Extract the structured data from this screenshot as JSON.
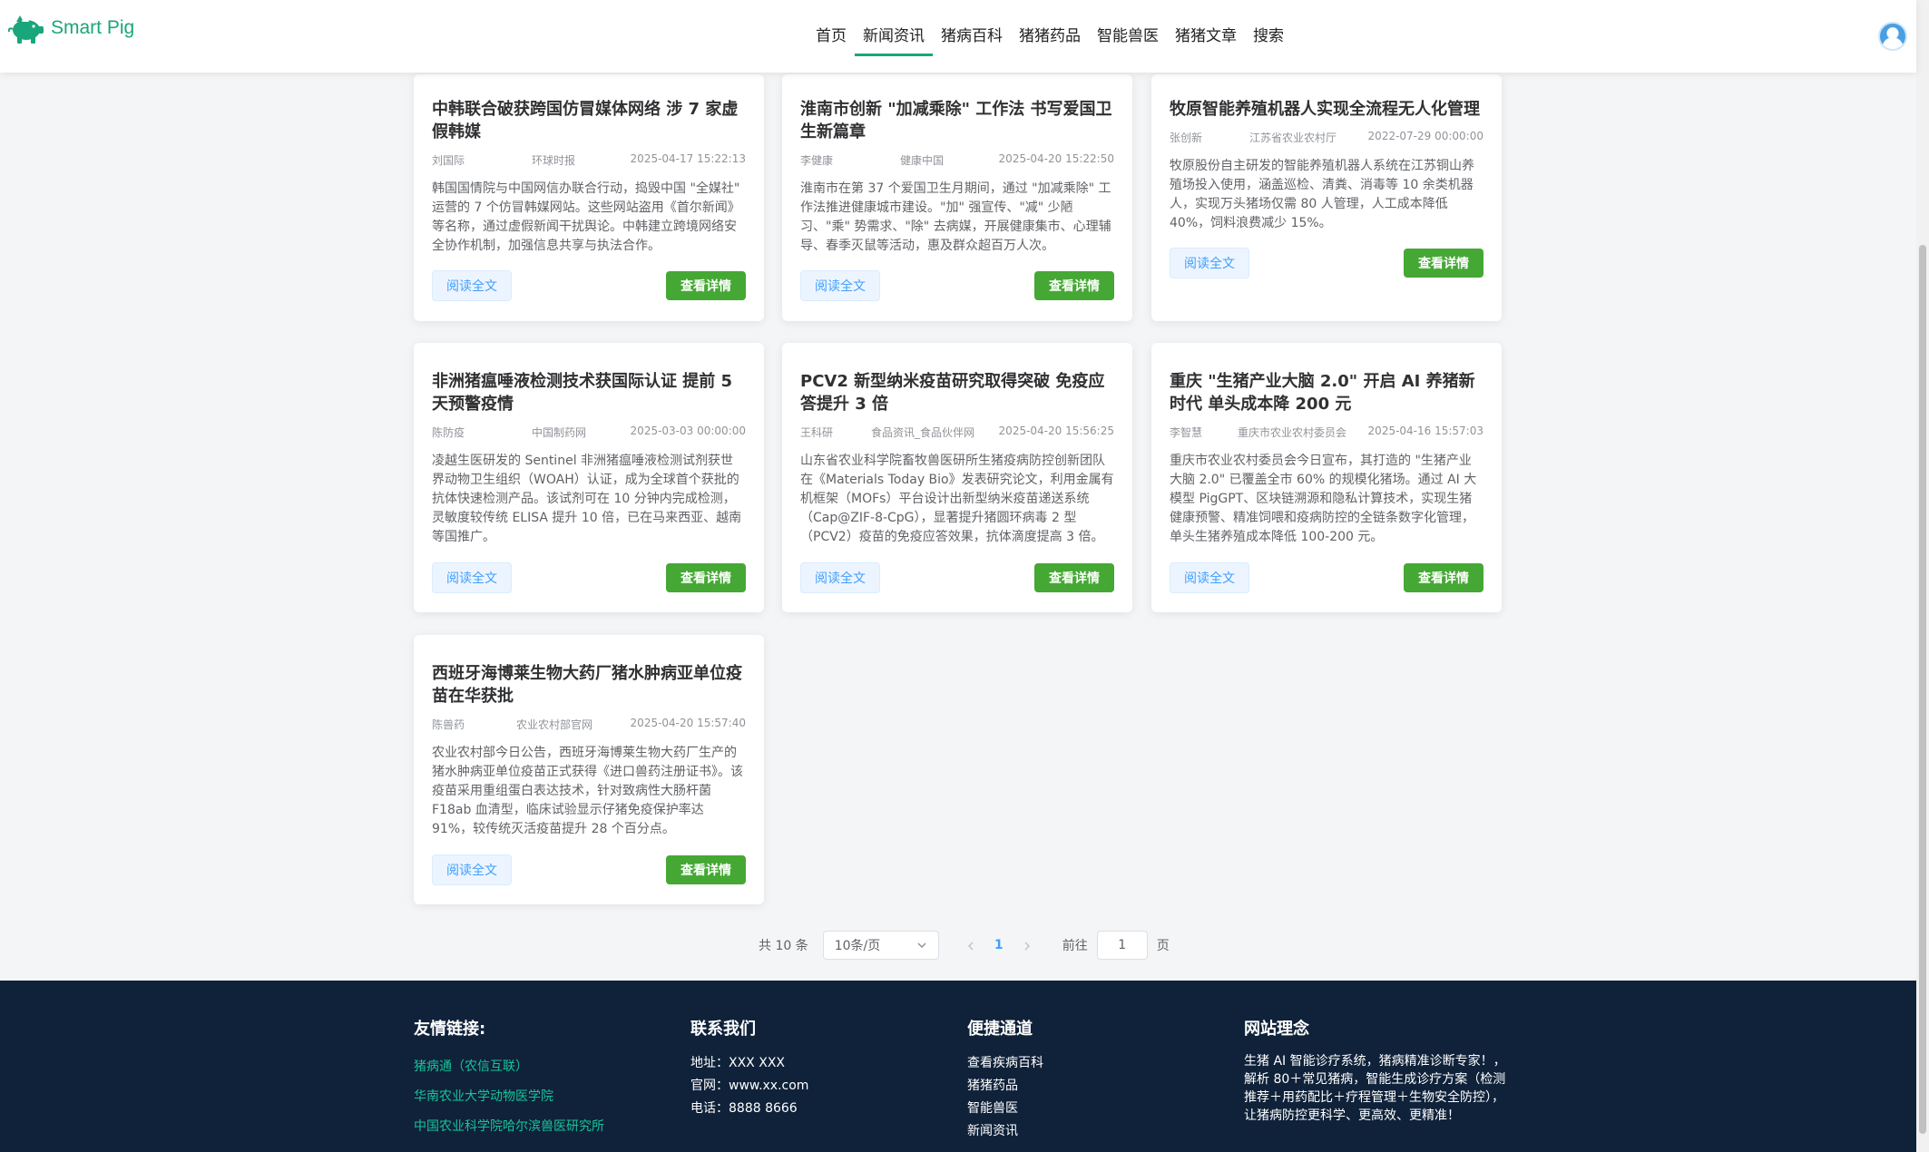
{
  "header": {
    "logo_text": "Smart Pig",
    "nav": [
      "首页",
      "新闻资讯",
      "猪病百科",
      "猪猪药品",
      "智能兽医",
      "猪猪文章",
      "搜索"
    ],
    "active_nav": "新闻资讯"
  },
  "cards": [
    {
      "title": "中韩联合破获跨国仿冒媒体网络 涉 7 家虚假韩媒",
      "author": "刘国际",
      "source": "环球时报",
      "date": "2025-04-17 15:22:13",
      "summary": "韩国国情院与中国网信办联合行动，捣毁中国 \"全媒社\" 运营的 7 个仿冒韩媒网站。这些网站盗用《首尔新闻》等名称，通过虚假新闻干扰舆论。中韩建立跨境网络安全协作机制，加强信息共享与执法合作。",
      "read_label": "阅读全文",
      "detail_label": "查看详情"
    },
    {
      "title": "淮南市创新 \"加减乘除\" 工作法 书写爱国卫生新篇章",
      "author": "李健康",
      "source": "健康中国",
      "date": "2025-04-20 15:22:50",
      "summary": "淮南市在第 37 个爱国卫生月期间，通过 \"加减乘除\" 工作法推进健康城市建设。\"加\" 强宣传、\"减\" 少陋习、\"乘\" 势需求、\"除\" 去病媒，开展健康集市、心理辅导、春季灭鼠等活动，惠及群众超百万人次。",
      "read_label": "阅读全文",
      "detail_label": "查看详情"
    },
    {
      "title": "牧原智能养殖机器人实现全流程无人化管理",
      "author": "张创新",
      "source": "江苏省农业农村厅",
      "date": "2022-07-29 00:00:00",
      "summary": "牧原股份自主研发的智能养殖机器人系统在江苏铜山养殖场投入使用，涵盖巡检、清粪、消毒等 10 余类机器人，实现万头猪场仅需 80 人管理，人工成本降低 40%，饲料浪费减少 15%。",
      "read_label": "阅读全文",
      "detail_label": "查看详情"
    },
    {
      "title": "非洲猪瘟唾液检测技术获国际认证 提前 5 天预警疫情",
      "author": "陈防疫",
      "source": "中国制药网",
      "date": "2025-03-03 00:00:00",
      "summary": "凌越生医研发的 Sentinel 非洲猪瘟唾液检测试剂获世界动物卫生组织（WOAH）认证，成为全球首个获批的抗体快速检测产品。该试剂可在 10 分钟内完成检测，灵敏度较传统 ELISA 提升 10 倍，已在马来西亚、越南等国推广。",
      "read_label": "阅读全文",
      "detail_label": "查看详情"
    },
    {
      "title": "PCV2 新型纳米疫苗研究取得突破 免疫应答提升 3 倍",
      "author": "王科研",
      "source": "食品资讯_食品伙伴网",
      "date": "2025-04-20 15:56:25",
      "summary": "山东省农业科学院畜牧兽医研所生猪疫病防控创新团队在《Materials Today Bio》发表研究论文，利用金属有机框架（MOFs）平台设计出新型纳米疫苗递送系统（Cap@ZIF-8-CpG），显著提升猪圆环病毒 2 型（PCV2）疫苗的免疫应答效果，抗体滴度提高 3 倍。",
      "read_label": "阅读全文",
      "detail_label": "查看详情"
    },
    {
      "title": "重庆 \"生猪产业大脑 2.0\" 开启 AI 养猪新时代 单头成本降 200 元",
      "author": "李智慧",
      "source": "重庆市农业农村委员会",
      "date": "2025-04-16 15:57:03",
      "summary": "重庆市农业农村委员会今日宣布，其打造的 \"生猪产业大脑 2.0\" 已覆盖全市 60% 的规模化猪场。通过 AI 大模型 PigGPT、区块链溯源和隐私计算技术，实现生猪健康预警、精准饲喂和疫病防控的全链条数字化管理，单头生猪养殖成本降低 100-200 元。",
      "read_label": "阅读全文",
      "detail_label": "查看详情"
    },
    {
      "title": "西班牙海博莱生物大药厂猪水肿病亚单位疫苗在华获批",
      "author": "陈兽药",
      "source": "农业农村部官网",
      "date": "2025-04-20 15:57:40",
      "summary": "农业农村部今日公告，西班牙海博莱生物大药厂生产的猪水肿病亚单位疫苗正式获得《进口兽药注册证书》。该疫苗采用重组蛋白表达技术，针对致病性大肠杆菌 F18ab 血清型，临床试验显示仔猪免疫保护率达 91%，较传统灭活疫苗提升 28 个百分点。",
      "read_label": "阅读全文",
      "detail_label": "查看详情"
    }
  ],
  "pagination": {
    "total_label": "共 10 条",
    "page_size": "10条/页",
    "current_page": "1",
    "goto_label": "前往",
    "goto_value": "1",
    "page_suffix": "页"
  },
  "footer": {
    "links_title": "友情链接:",
    "links": [
      "猪病通（农信互联）",
      "华南农业大学动物医学院",
      "中国农业科学院哈尔滨兽医研究所"
    ],
    "contact_title": "联系我们",
    "contact": [
      "地址：XXX XXX",
      "官网：www.xx.com",
      "电话：8888 8666"
    ],
    "quick_title": "便捷通道",
    "quick": [
      "查看疾病百科",
      "猪猪药品",
      "智能兽医",
      "新闻资讯"
    ],
    "idea_title": "网站理念",
    "idea_text": "生猪 AI 智能诊疗系统，猪病精准诊断专家！，解析 80＋常见猪病，智能生成诊疗方案（检测推荐＋用药配比＋疗程管理＋生物安全防控），让猪病防控更科学、更高效、更精准！"
  },
  "colors": {
    "brand": "#19a67a",
    "detail_button": "#45a834",
    "read_button_text": "#409eff",
    "footer_bg": "#0f223a",
    "footer_link": "#19c29a"
  },
  "icons": [
    "pig-logo-icon",
    "user-avatar-icon",
    "chevron-down-icon",
    "chevron-left-icon",
    "chevron-right-icon"
  ]
}
